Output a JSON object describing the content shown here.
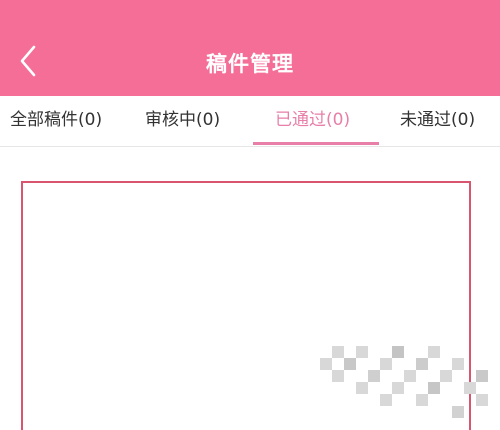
{
  "header": {
    "title": "稿件管理",
    "back_icon": "chevron-left-icon"
  },
  "tabs": [
    {
      "label": "全部稿件(0)",
      "active": false
    },
    {
      "label": "审核中(0)",
      "active": false
    },
    {
      "label": "已通过(0)",
      "active": true
    },
    {
      "label": "未通过(0)",
      "active": false
    }
  ],
  "colors": {
    "header_bg": "#f56e97",
    "active_tab": "#e77fa9",
    "panel_border": "#d9546f"
  }
}
